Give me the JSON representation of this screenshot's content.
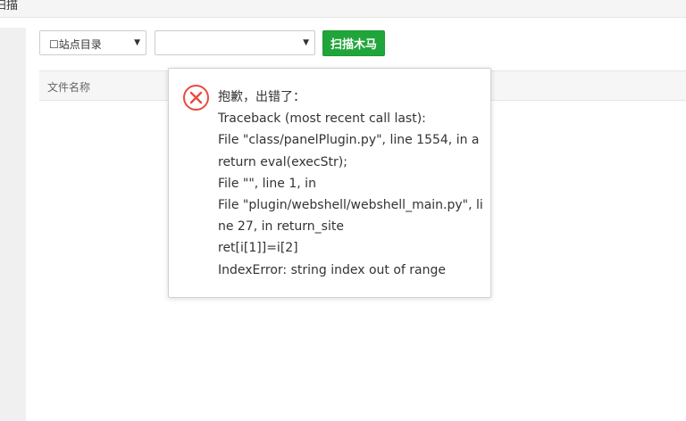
{
  "window": {
    "title": "扫描"
  },
  "toolbar": {
    "site_select_value": "☐站点目录",
    "second_select_value": "",
    "scan_button_label": "扫描木马"
  },
  "table": {
    "columns": [
      "文件名称"
    ]
  },
  "error_dialog": {
    "icon": "x-circle-icon",
    "lines": [
      "抱歉，出错了：",
      "Traceback (most recent call last):",
      "File \"class/panelPlugin.py\", line 1554, in a",
      "return eval(execStr);",
      "File \"\", line 1, in",
      "File \"plugin/webshell/webshell_main.py\", li",
      "ne 27, in return_site",
      "ret[i[1]]=i[2]",
      "IndexError: string index out of range"
    ]
  },
  "colors": {
    "accent_green": "#20a53a",
    "error_red": "#e84c3d"
  }
}
